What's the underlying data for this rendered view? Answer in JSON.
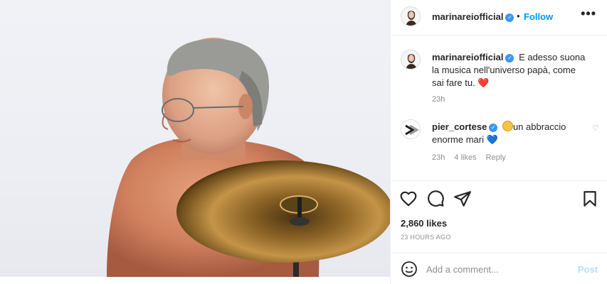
{
  "post": {
    "author": "marinareiofficial",
    "follow_label": "Follow",
    "separator": "•",
    "more_label": "•••"
  },
  "caption": {
    "username": "marinareiofficial",
    "text": "E adesso suona la musica nell'universo papà, come sai fare tu.",
    "emoji": "❤️",
    "time": "23h"
  },
  "reply": {
    "username": "pier_cortese",
    "text_part1": "un abbraccio enorme mari",
    "emoji_end": "💙",
    "time": "23h",
    "likes": "4 likes",
    "reply_label": "Reply"
  },
  "stats": {
    "likes": "2,860 likes",
    "time_ago": "23 HOURS AGO"
  },
  "add_comment": {
    "placeholder": "Add a comment...",
    "post_label": "Post"
  },
  "colors": {
    "accent": "#0095f6",
    "verified": "#3897f0",
    "post_disabled": "#b2dffc",
    "muted": "#8e8e8e"
  },
  "icons": {
    "like": "heart-outline-icon",
    "comment": "comment-bubble-icon",
    "share": "paper-plane-icon",
    "save": "bookmark-icon",
    "emoji": "smiley-icon"
  }
}
